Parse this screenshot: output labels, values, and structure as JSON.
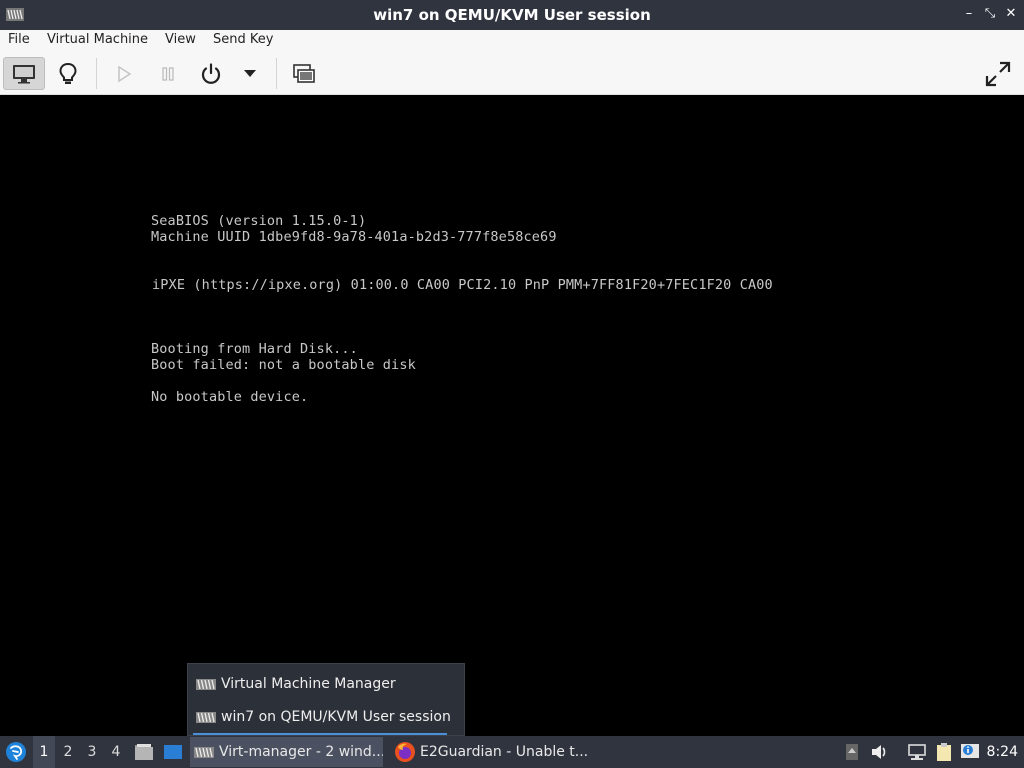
{
  "window": {
    "title": "win7 on QEMU/KVM User session",
    "minimize_glyph": "–",
    "maximize_glyph": "⤡",
    "close_glyph": "✕"
  },
  "menu": {
    "items": [
      "File",
      "Virtual Machine",
      "View",
      "Send Key"
    ]
  },
  "toolbar": {
    "icons": [
      "monitor-icon",
      "lightbulb-icon",
      "play-icon",
      "pause-icon",
      "power-icon",
      "dropdown-arrow-icon",
      "screenshot-icon",
      "fullscreen-icon"
    ]
  },
  "console": {
    "lines": [
      "SeaBIOS (version 1.15.0-1)",
      "Machine UUID 1dbe9fd8-9a78-401a-b2d3-777f8e58ce69",
      "iPXE (https://ipxe.org) 01:00.0 CA00 PCI2.10 PnP PMM+7FF81F20+7FEC1F20 CA00",
      "Booting from Hard Disk...",
      "Boot failed: not a bootable disk",
      "No bootable device."
    ]
  },
  "popup": {
    "items": [
      "Virtual Machine Manager",
      "win7 on QEMU/KVM User session"
    ]
  },
  "taskbar": {
    "workspaces": [
      "1",
      "2",
      "3",
      "4"
    ],
    "tasks": [
      "Virt-manager - 2 wind...",
      "E2Guardian - Unable t..."
    ],
    "clock": "8:24"
  },
  "colors": {
    "titlebar": "#2f343f",
    "panel": "#2f343f",
    "console_text": "#c8c8c8",
    "accent": "#4a90d9"
  }
}
